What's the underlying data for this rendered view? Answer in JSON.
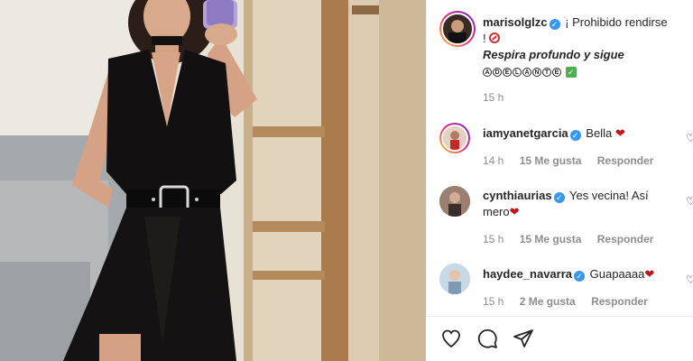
{
  "post": {
    "author": "marisolglzc",
    "caption_top": "¡ Prohibido rendirse !",
    "caption_line2": "Respira profundo y sigue",
    "caption_line3_letters": [
      "A",
      "D",
      "E",
      "L",
      "A",
      "N",
      "T",
      "E"
    ],
    "time": "15 h"
  },
  "comments": [
    {
      "user": "iamyanetgarcia",
      "text": "Bella",
      "time": "14 h",
      "likes": "15 Me gusta",
      "reply": "Responder"
    },
    {
      "user": "cynthiaurias",
      "text": "Yes vecina! Así mero",
      "time": "15 h",
      "likes": "15 Me gusta",
      "reply": "Responder"
    },
    {
      "user": "haydee_navarra",
      "text": "Guapaaaa",
      "time": "15 h",
      "likes": "2 Me gusta",
      "reply": "Responder"
    }
  ],
  "icons": [
    "heart-icon",
    "comment-icon",
    "share-icon",
    "verified-badge"
  ],
  "colors": {
    "verified": "#3897f0",
    "heart_red": "#c0141b",
    "text": "#262626",
    "muted": "#8e8e8e"
  }
}
